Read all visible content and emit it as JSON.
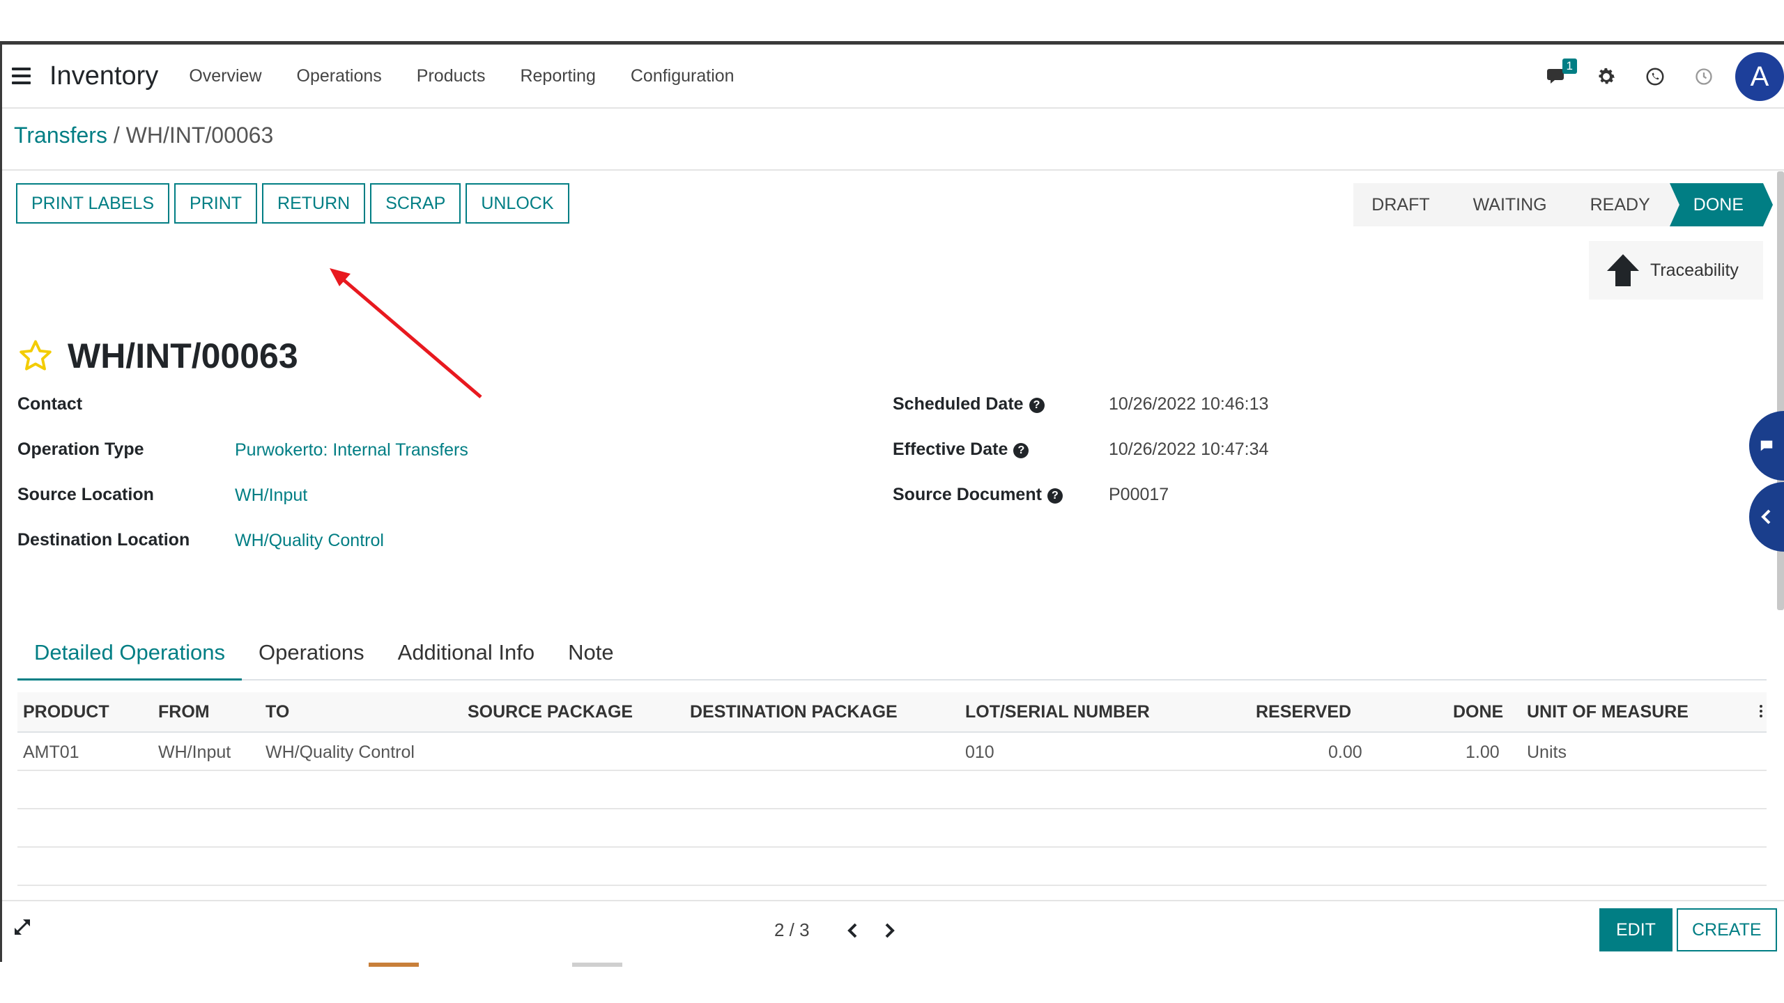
{
  "navbar": {
    "app_title": "Inventory",
    "items": [
      "Overview",
      "Operations",
      "Products",
      "Reporting",
      "Configuration"
    ],
    "messages_badge": "1",
    "avatar_initial": "A"
  },
  "breadcrumb": {
    "parent": "Transfers",
    "separator": " / ",
    "current": "WH/INT/00063"
  },
  "actions": [
    "PRINT LABELS",
    "PRINT",
    "RETURN",
    "SCRAP",
    "UNLOCK"
  ],
  "statusbar": {
    "states": [
      "DRAFT",
      "WAITING",
      "READY",
      "DONE"
    ],
    "active": "DONE"
  },
  "traceability_label": "Traceability",
  "record": {
    "name": "WH/INT/00063"
  },
  "fields_left": [
    {
      "label": "Contact",
      "value": ""
    },
    {
      "label": "Operation Type",
      "value": "Purwokerto: Internal Transfers"
    },
    {
      "label": "Source Location",
      "value": "WH/Input"
    },
    {
      "label": "Destination Location",
      "value": "WH/Quality Control"
    }
  ],
  "fields_right": [
    {
      "label": "Scheduled Date",
      "value": "10/26/2022 10:46:13"
    },
    {
      "label": "Effective Date",
      "value": "10/26/2022 10:47:34"
    },
    {
      "label": "Source Document",
      "value": "P00017"
    }
  ],
  "tabs": [
    "Detailed Operations",
    "Operations",
    "Additional Info",
    "Note"
  ],
  "table": {
    "columns": [
      "PRODUCT",
      "FROM",
      "TO",
      "SOURCE PACKAGE",
      "DESTINATION PACKAGE",
      "LOT/SERIAL NUMBER",
      "RESERVED",
      "DONE",
      "UNIT OF MEASURE"
    ],
    "rows": [
      [
        "AMT01",
        "WH/Input",
        "WH/Quality Control",
        "",
        "",
        "010",
        "0.00",
        "1.00",
        "Units"
      ]
    ]
  },
  "pager": {
    "text": "2 / 3"
  },
  "buttons": {
    "edit": "EDIT",
    "create": "CREATE"
  },
  "colors": {
    "primary": "#017e84",
    "avatar": "#1d3f9a",
    "annotation_arrow": "#e8191f",
    "star": "#f3cc00"
  }
}
